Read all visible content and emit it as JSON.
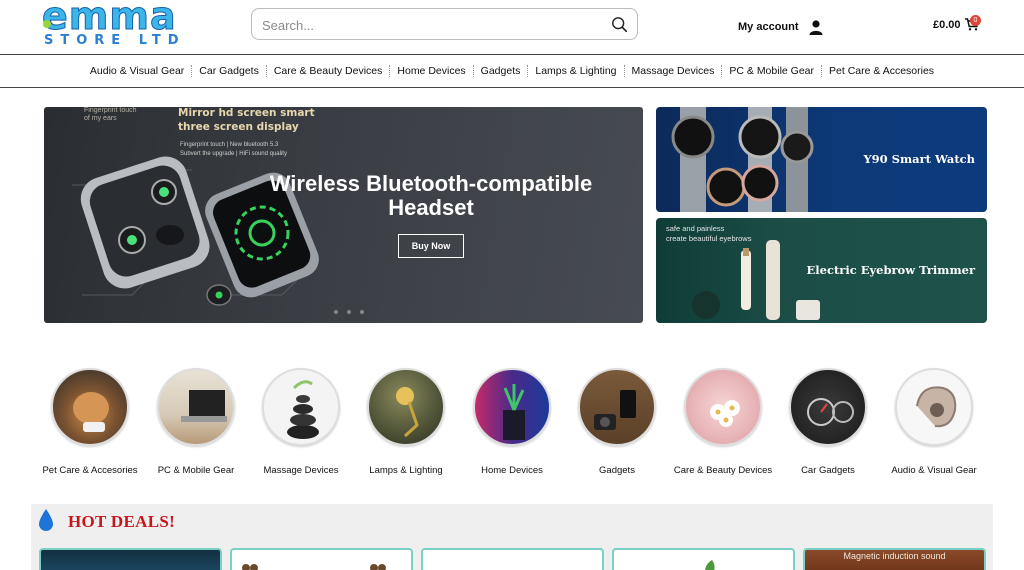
{
  "header": {
    "logo_text_top": "emma",
    "logo_text_bottom": "STORE LTD",
    "search_placeholder": "Search...",
    "account_label": "My account",
    "cart_total": "£0.00",
    "cart_count": "0"
  },
  "nav": {
    "items": [
      "Audio & Visual Gear",
      "Car Gadgets",
      "Care & Beauty Devices",
      "Home Devices",
      "Gadgets",
      "Lamps & Lighting",
      "Massage Devices",
      "PC & Mobile Gear",
      "Pet Care & Accesories"
    ]
  },
  "hero": {
    "small_text": "Fingerprint touch\nof my ears",
    "caption_line1": "Mirror hd screen smart",
    "caption_line2": "three screen display",
    "caption_small1": "Fingerprint touch | New bluetooth 5.3",
    "caption_small2": "Subvert the upgrade | HiFi sound quality",
    "title": "Wireless Bluetooth-compatible Headset",
    "button_label": "Buy Now",
    "dots": 3
  },
  "banners": {
    "watch_label": "Y90 Smart Watch",
    "trimmer_label": "Electric Eyebrow Trimmer",
    "trimmer_subtext1": "safe and painless",
    "trimmer_subtext2": "create beautiful eyebrows"
  },
  "categories": [
    "Pet Care & Accesories",
    "PC & Mobile Gear",
    "Massage Devices",
    "Lamps & Lighting",
    "Home Devices",
    "Gadgets",
    "Care & Beauty Devices",
    "Car Gadgets",
    "Audio & Visual Gear"
  ],
  "deals": {
    "title": "HOT DEALS!",
    "card5_caption": "Magnetic induction sound"
  },
  "colors": {
    "deals_title": "#c8161d",
    "deal_card_border": "#7ad0c4",
    "cart_badge": "#e0443a",
    "logo_blue": "#3ab6e8"
  }
}
